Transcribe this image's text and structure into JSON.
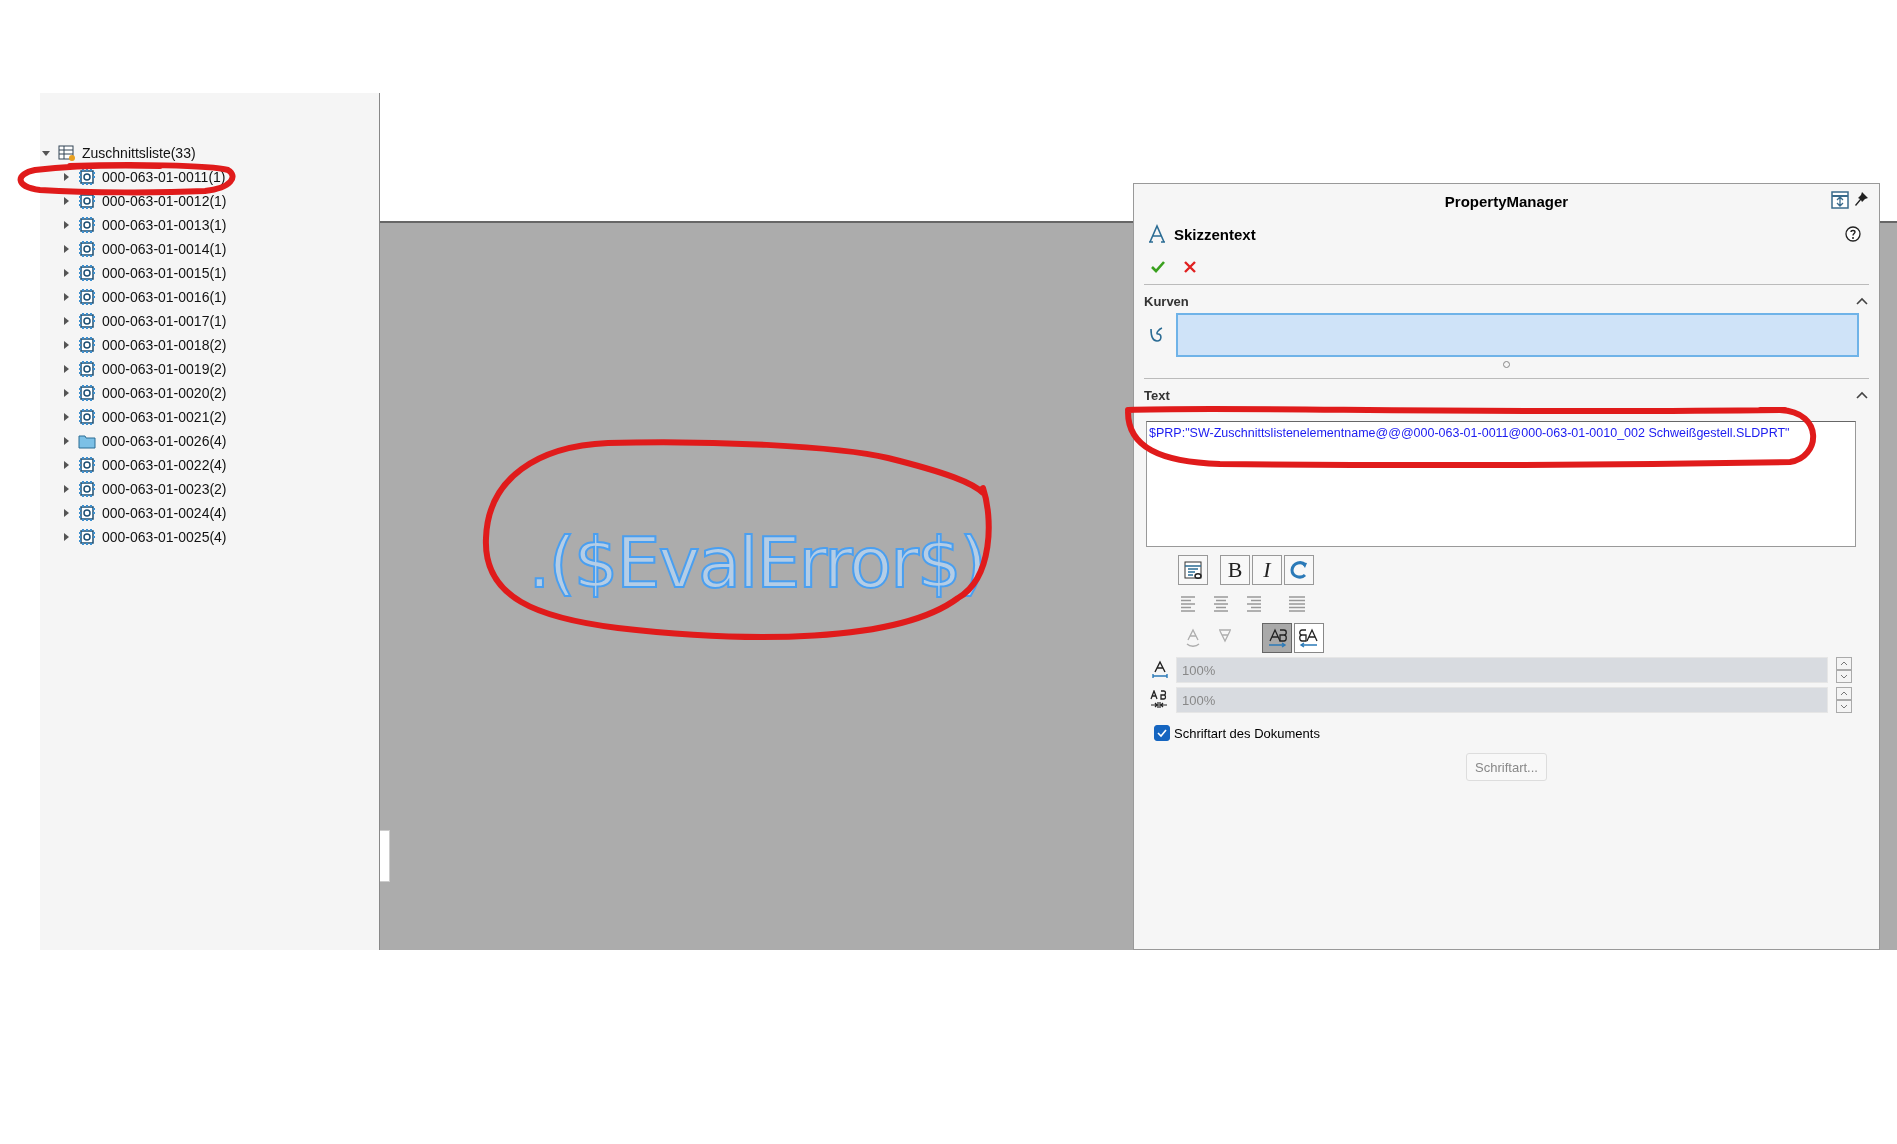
{
  "tree": {
    "items": [
      {
        "label": "Zuschnittsliste(33)",
        "kind": "cutlist",
        "expanded": true,
        "children": [
          {
            "label": "000-063-01-0011(1)",
            "kind": "part",
            "expanded": false
          },
          {
            "label": "000-063-01-0012(1)",
            "kind": "part",
            "expanded": false
          },
          {
            "label": "000-063-01-0013(1)",
            "kind": "part",
            "expanded": false
          },
          {
            "label": "000-063-01-0014(1)",
            "kind": "part",
            "expanded": false
          },
          {
            "label": "000-063-01-0015(1)",
            "kind": "part",
            "expanded": false
          },
          {
            "label": "000-063-01-0016(1)",
            "kind": "part",
            "expanded": false
          },
          {
            "label": "000-063-01-0017(1)",
            "kind": "part",
            "expanded": false
          },
          {
            "label": "000-063-01-0018(2)",
            "kind": "part",
            "expanded": false
          },
          {
            "label": "000-063-01-0019(2)",
            "kind": "part",
            "expanded": false
          },
          {
            "label": "000-063-01-0020(2)",
            "kind": "part",
            "expanded": false
          },
          {
            "label": "000-063-01-0021(2)",
            "kind": "part",
            "expanded": false
          },
          {
            "label": "000-063-01-0026(4)",
            "kind": "folder",
            "expanded": false
          },
          {
            "label": "000-063-01-0022(4)",
            "kind": "part",
            "expanded": false
          },
          {
            "label": "000-063-01-0023(2)",
            "kind": "part",
            "expanded": false
          },
          {
            "label": "000-063-01-0024(4)",
            "kind": "part",
            "expanded": false
          },
          {
            "label": "000-063-01-0025(4)",
            "kind": "part",
            "expanded": false
          }
        ]
      }
    ]
  },
  "viewport": {
    "sketch_text": ".($EvalError$)"
  },
  "property_manager": {
    "title": "PropertyManager",
    "feature_title": "Skizzentext",
    "curves_section": {
      "title": "Kurven",
      "expanded": true
    },
    "text_section": {
      "title": "Text",
      "expanded": true,
      "value": "$PRP:\"SW-Zuschnittslistenelementname@@@000-063-01-0011@000-063-01-0010_002 Schweißgestell.SLDPRT\""
    },
    "format_buttons": [
      {
        "kind": "link"
      },
      {
        "kind": "bold",
        "label": "B"
      },
      {
        "kind": "italic",
        "label": "I"
      },
      {
        "kind": "rotate"
      }
    ],
    "alignment_buttons": [
      {
        "kind": "left"
      },
      {
        "kind": "center"
      },
      {
        "kind": "right"
      },
      {
        "kind": "justify"
      }
    ],
    "direction_buttons": [
      {
        "kind": "flip-vertical",
        "disabled": true,
        "selected": false
      },
      {
        "kind": "flip-horizontal",
        "disabled": true,
        "selected": false
      },
      {
        "kind": "ltr",
        "disabled": false,
        "selected": true
      },
      {
        "kind": "rtl",
        "disabled": false,
        "selected": false
      }
    ],
    "fields": [
      {
        "kind": "width",
        "value": "100%",
        "disabled": true
      },
      {
        "kind": "spacing",
        "value": "100%",
        "disabled": true
      }
    ],
    "document_font": {
      "label": "Schriftart des Dokuments",
      "checked": true
    },
    "font_button": {
      "label": "Schriftart...",
      "disabled": true
    }
  }
}
